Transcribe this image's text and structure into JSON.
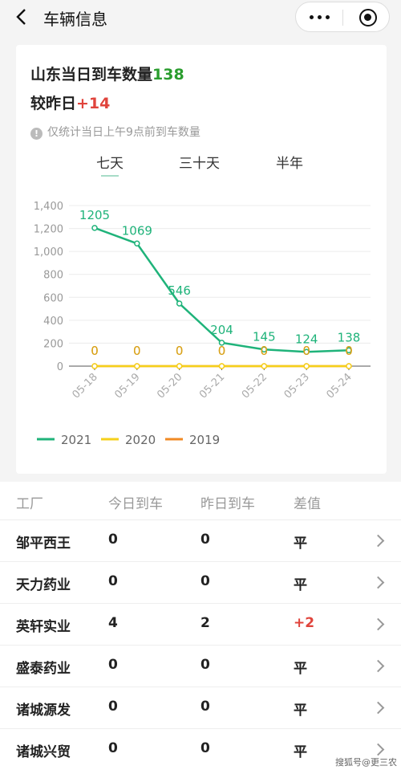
{
  "header": {
    "title": "车辆信息",
    "more_icon": "more-dots-icon",
    "close_icon": "target-icon",
    "back_icon": "chevron-left-icon"
  },
  "summary": {
    "headline_prefix": "山东当日到车数量",
    "headline_value": "138",
    "compare_prefix": "较昨日",
    "compare_value": "+14",
    "note": "仅统计当日上午9点前到车数量"
  },
  "range_tabs": [
    "七天",
    "三十天",
    "半年"
  ],
  "chart_data": {
    "type": "line",
    "x": [
      "05-18",
      "05-19",
      "05-20",
      "05-21",
      "05-22",
      "05-23",
      "05-24"
    ],
    "y_ticks": [
      "0",
      "200",
      "400",
      "600",
      "800",
      "1,000",
      "1,200",
      "1,400"
    ],
    "ylim": [
      0,
      1400
    ],
    "series": [
      {
        "name": "2021",
        "color": "#1fb37a",
        "values": [
          1205,
          1069,
          546,
          204,
          145,
          124,
          138
        ]
      },
      {
        "name": "2020",
        "color": "#f5d01b",
        "values": [
          0,
          0,
          0,
          0,
          0,
          0,
          0
        ]
      },
      {
        "name": "2019",
        "color": "#f08a24",
        "values": [
          0,
          0,
          0,
          0,
          0,
          0,
          0
        ]
      }
    ],
    "label_color_zero": "#d9a21a"
  },
  "table": {
    "headers": [
      "工厂",
      "今日到车",
      "昨日到车",
      "差值"
    ],
    "rows": [
      {
        "factory": "邹平西王",
        "today": "0",
        "yesterday": "0",
        "diff": "平"
      },
      {
        "factory": "天力药业",
        "today": "0",
        "yesterday": "0",
        "diff": "平"
      },
      {
        "factory": "英轩实业",
        "today": "4",
        "yesterday": "2",
        "diff": "+2"
      },
      {
        "factory": "盛泰药业",
        "today": "0",
        "yesterday": "0",
        "diff": "平"
      },
      {
        "factory": "诸城源发",
        "today": "0",
        "yesterday": "0",
        "diff": "平"
      },
      {
        "factory": "诸城兴贸",
        "today": "0",
        "yesterday": "0",
        "diff": "平"
      }
    ]
  },
  "watermark": "搜狐号@更三农"
}
